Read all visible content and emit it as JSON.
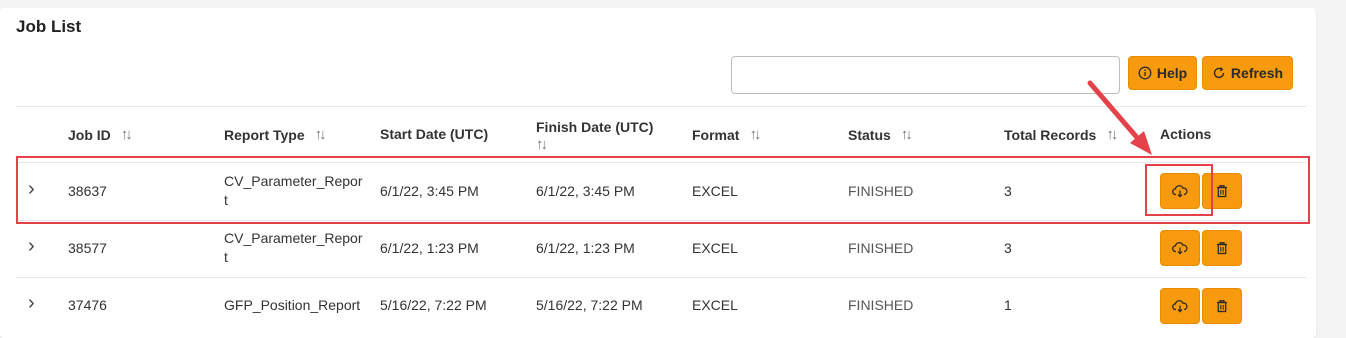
{
  "title": "Job List",
  "search": {
    "value": "",
    "placeholder": ""
  },
  "toolbar": {
    "help_label": "Help",
    "refresh_label": "Refresh"
  },
  "columns": {
    "job_id": "Job ID",
    "report_type": "Report Type",
    "start_date": "Start Date (UTC)",
    "finish_date": "Finish Date (UTC)",
    "format": "Format",
    "status": "Status",
    "total_records": "Total Records",
    "actions": "Actions"
  },
  "rows": [
    {
      "job_id": "38637",
      "report_type": "CV_Parameter_Report",
      "start_date": "6/1/22, 3:45 PM",
      "finish_date": "6/1/22, 3:45 PM",
      "format": "EXCEL",
      "status": "FINISHED",
      "total_records": "3"
    },
    {
      "job_id": "38577",
      "report_type": "CV_Parameter_Report",
      "start_date": "6/1/22, 1:23 PM",
      "finish_date": "6/1/22, 1:23 PM",
      "format": "EXCEL",
      "status": "FINISHED",
      "total_records": "3"
    },
    {
      "job_id": "37476",
      "report_type": "GFP_Position_Report",
      "start_date": "5/16/22, 7:22 PM",
      "finish_date": "5/16/22, 7:22 PM",
      "format": "EXCEL",
      "status": "FINISHED",
      "total_records": "1"
    }
  ],
  "icons": {
    "help": "info-circle-icon",
    "refresh": "refresh-icon",
    "expand": "chevron-right-icon",
    "sort": "sort-icon",
    "download": "cloud-download-icon",
    "delete": "trash-icon"
  },
  "colors": {
    "accent": "#f79a0e",
    "highlight": "#e5414a"
  }
}
